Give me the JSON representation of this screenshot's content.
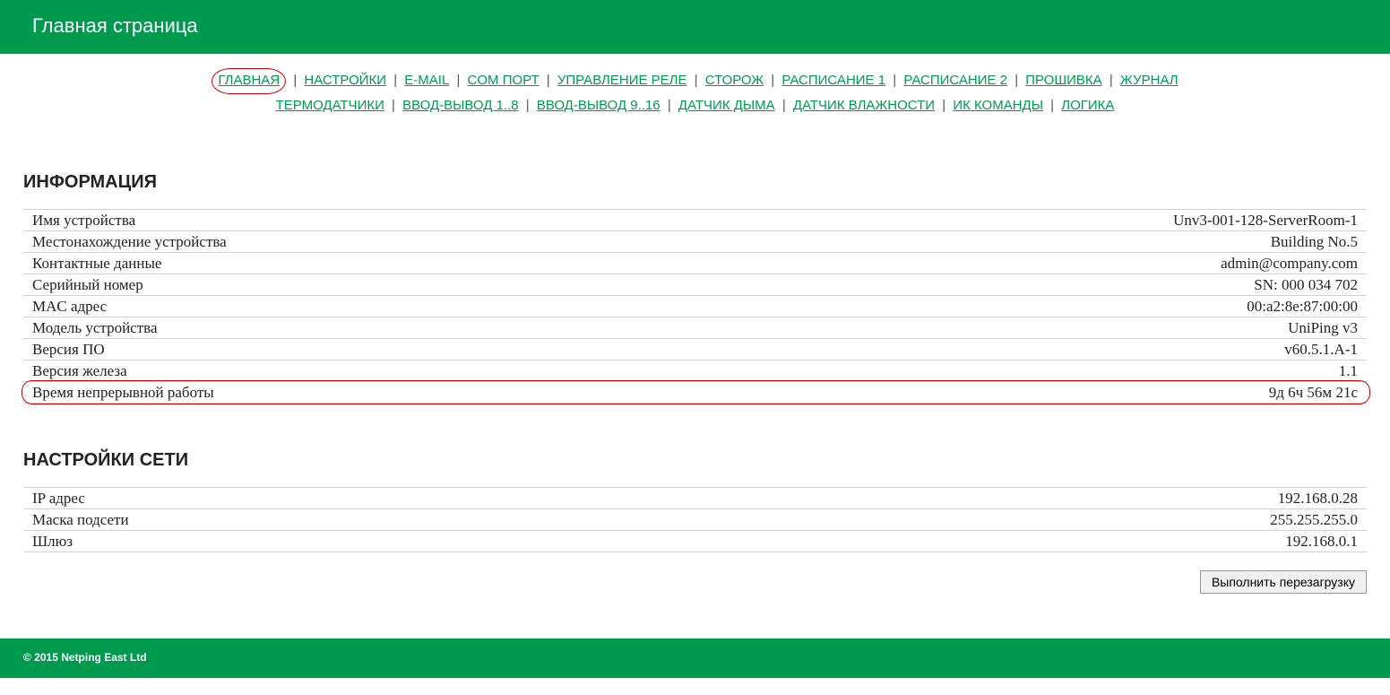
{
  "header": {
    "title": "Главная страница"
  },
  "nav": {
    "row1": [
      "ГЛАВНАЯ",
      "НАСТРОЙКИ",
      "E-MAIL",
      "COM ПОРТ",
      "УПРАВЛЕНИЕ РЕЛЕ",
      "СТОРОЖ",
      "РАСПИСАНИЕ 1",
      "РАСПИСАНИЕ 2",
      "ПРОШИВКА",
      "ЖУРНАЛ"
    ],
    "row2": [
      "ТЕРМОДАТЧИКИ",
      "ВВОД-ВЫВОД 1..8",
      "ВВОД-ВЫВОД 9..16",
      "ДАТЧИК ДЫМА",
      "ДАТЧИК ВЛАЖНОСТИ",
      "ИК КОМАНДЫ",
      "ЛОГИКА"
    ],
    "circled_index_row1": 0
  },
  "info": {
    "heading": "ИНФОРМАЦИЯ",
    "rows": [
      {
        "label": "Имя устройства",
        "value": "Unv3-001-128-ServerRoom-1"
      },
      {
        "label": "Местонахождение устройства",
        "value": "Building No.5"
      },
      {
        "label": "Контактные данные",
        "value": "admin@company.com"
      },
      {
        "label": "Серийный номер",
        "value": "SN: 000 034 702"
      },
      {
        "label": "MAC адрес",
        "value": "00:a2:8e:87:00:00"
      },
      {
        "label": "Модель устройства",
        "value": "UniPing v3"
      },
      {
        "label": "Версия ПО",
        "value": "v60.5.1.A-1"
      },
      {
        "label": "Версия железа",
        "value": "1.1"
      },
      {
        "label": "Время непрерывной работы",
        "value": "9д 6ч 56м 21с",
        "highlight": true
      }
    ]
  },
  "net": {
    "heading": "НАСТРОЙКИ СЕТИ",
    "rows": [
      {
        "label": "IP адрес",
        "value": "192.168.0.28"
      },
      {
        "label": "Маска подсети",
        "value": "255.255.255.0"
      },
      {
        "label": "Шлюз",
        "value": "192.168.0.1"
      }
    ]
  },
  "actions": {
    "reboot": "Выполнить перезагрузку"
  },
  "footer": {
    "copyright": "© 2015 Netping East Ltd"
  }
}
